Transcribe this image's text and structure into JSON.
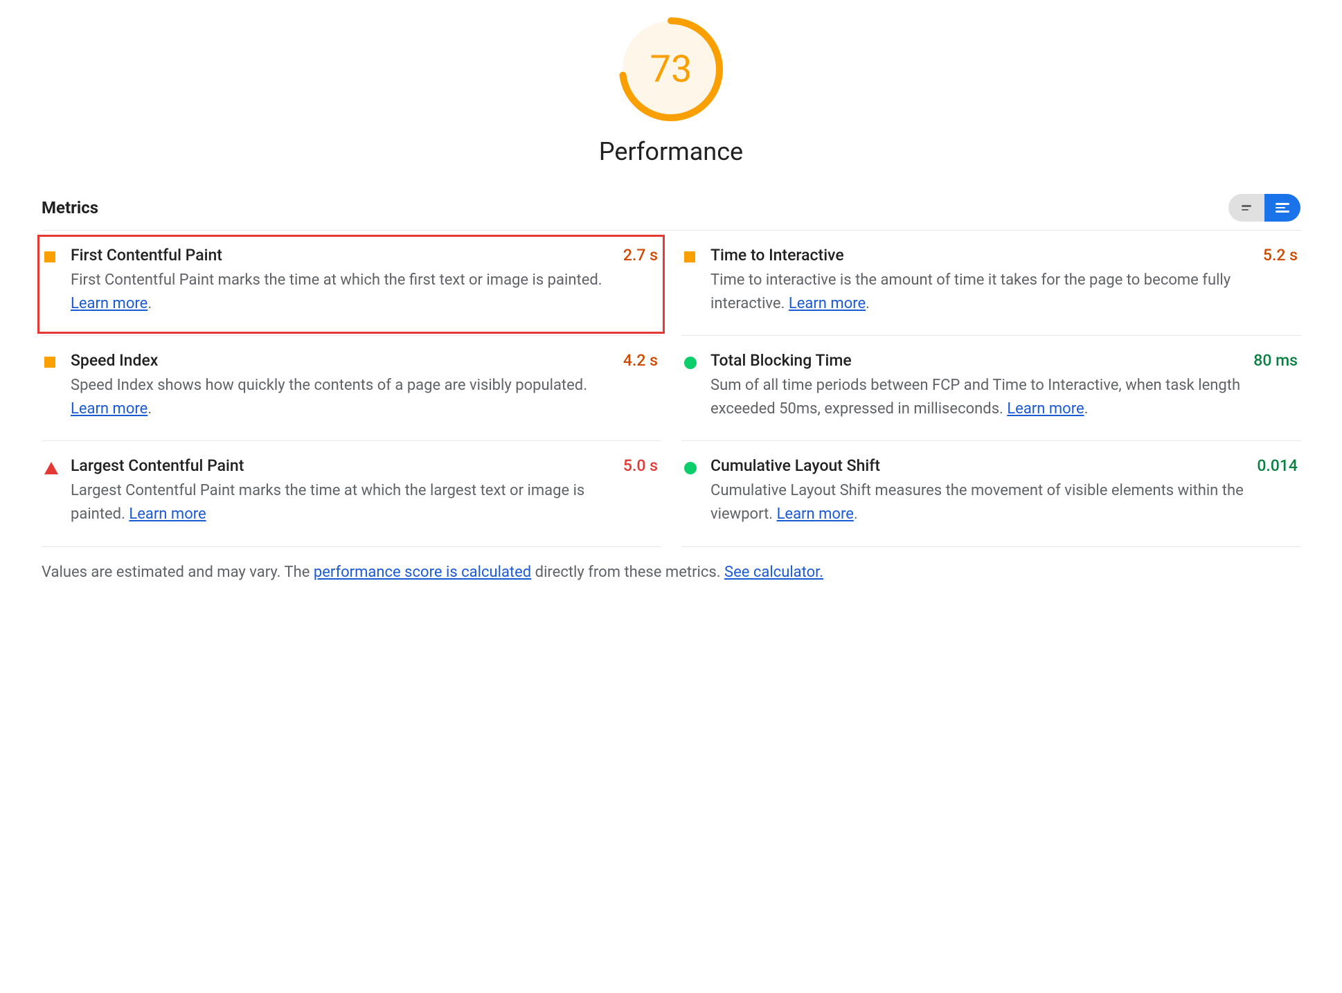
{
  "gauge": {
    "score": "73",
    "score_percent": 73,
    "title": "Performance",
    "color": "#fa9f00",
    "fill": "#fff6ea"
  },
  "metrics_header": "Metrics",
  "metrics": [
    {
      "name": "First Contentful Paint",
      "desc": "First Contentful Paint marks the time at which the first text or image is painted. ",
      "learn": "Learn more",
      "learn_suffix": ".",
      "value": "2.7 s",
      "icon": "square",
      "value_class": "orange",
      "highlighted": true
    },
    {
      "name": "Time to Interactive",
      "desc": "Time to interactive is the amount of time it takes for the page to become fully interactive. ",
      "learn": "Learn more",
      "learn_suffix": ".",
      "value": "5.2 s",
      "icon": "square",
      "value_class": "orange",
      "highlighted": false
    },
    {
      "name": "Speed Index",
      "desc": "Speed Index shows how quickly the contents of a page are visibly populated. ",
      "learn": "Learn more",
      "learn_suffix": ".",
      "value": "4.2 s",
      "icon": "square",
      "value_class": "orange",
      "highlighted": false
    },
    {
      "name": "Total Blocking Time",
      "desc": "Sum of all time periods between FCP and Time to Interactive, when task length exceeded 50ms, expressed in milliseconds. ",
      "learn": "Learn more",
      "learn_suffix": ".",
      "value": "80 ms",
      "icon": "dot",
      "value_class": "green",
      "highlighted": false
    },
    {
      "name": "Largest Contentful Paint",
      "desc": "Largest Contentful Paint marks the time at which the largest text or image is painted. ",
      "learn": "Learn more",
      "learn_suffix": "",
      "value": "5.0 s",
      "icon": "triangle",
      "value_class": "red",
      "highlighted": false
    },
    {
      "name": "Cumulative Layout Shift",
      "desc": "Cumulative Layout Shift measures the movement of visible elements within the viewport. ",
      "learn": "Learn more",
      "learn_suffix": ".",
      "value": "0.014",
      "icon": "dot",
      "value_class": "green",
      "highlighted": false
    }
  ],
  "footer": {
    "prefix": "Values are estimated and may vary. The ",
    "link1": "performance score is calculated",
    "middle": " directly from these metrics. ",
    "link2": "See calculator."
  }
}
